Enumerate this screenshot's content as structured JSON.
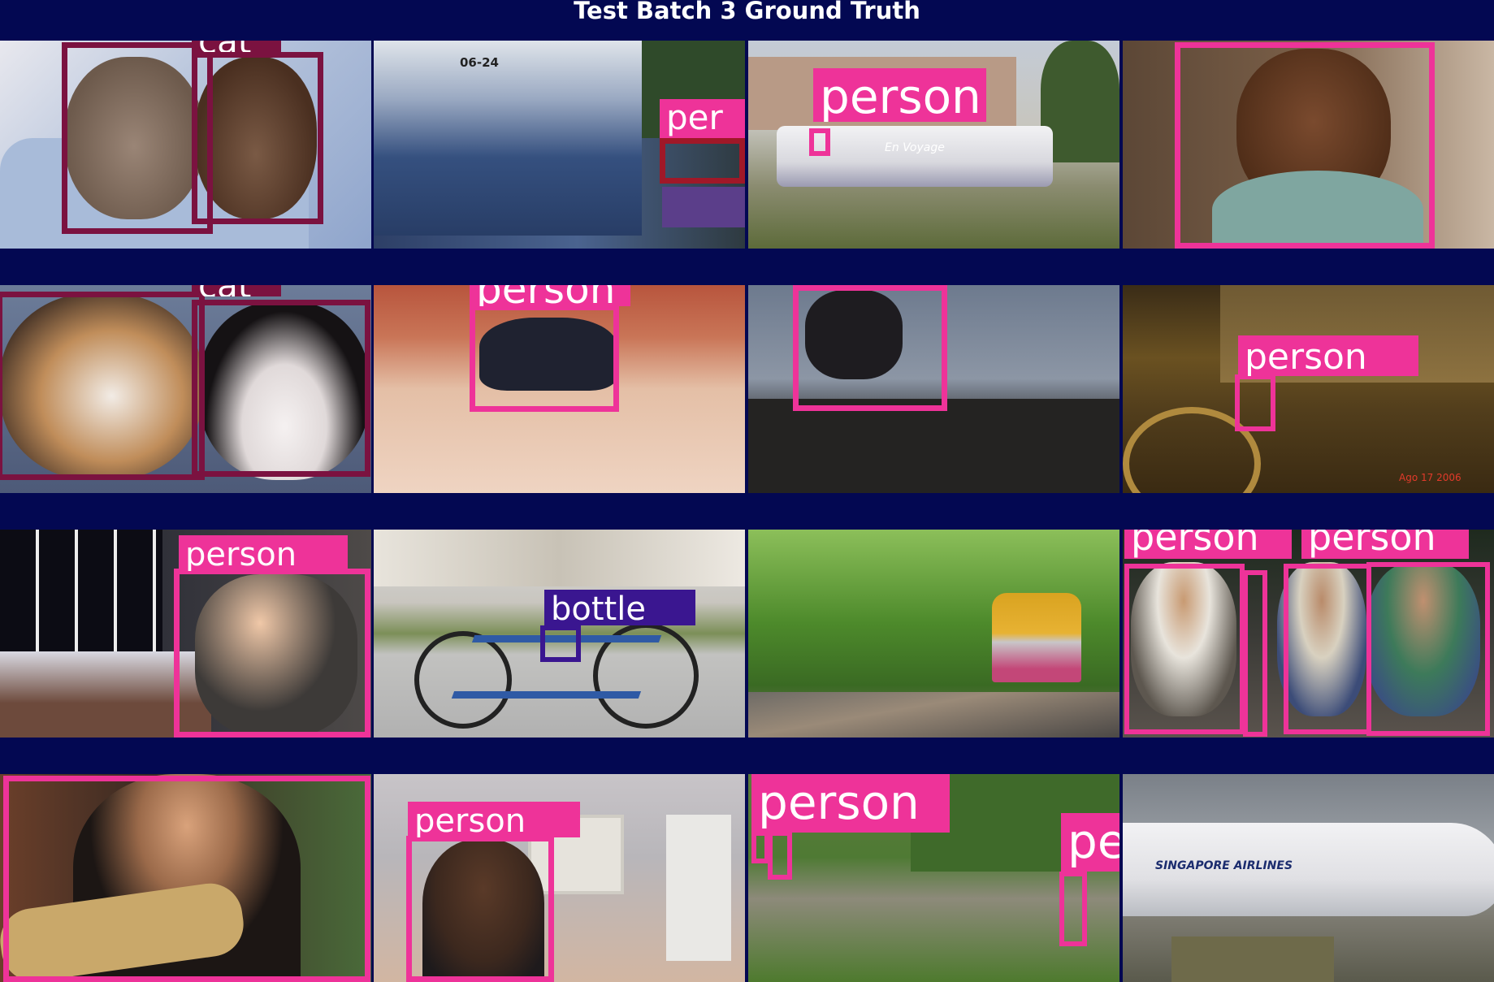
{
  "title": "Test Batch 3 Ground Truth",
  "colors": {
    "background": "#030852",
    "person": "#ee3399",
    "cat": "#7b1240",
    "bottle": "#3a1690",
    "bus_label": "#a01828"
  },
  "tiles": [
    {
      "name": "cats-on-pillow",
      "labels": [
        "cat"
      ]
    },
    {
      "name": "bus",
      "labels": [
        "per"
      ]
    },
    {
      "name": "train-white",
      "labels": [
        "person"
      ]
    },
    {
      "name": "woman-phone",
      "labels": []
    },
    {
      "name": "two-cats",
      "labels": [
        "cat"
      ]
    },
    {
      "name": "man-jumping",
      "labels": [
        "person"
      ]
    },
    {
      "name": "silhouette-jump",
      "labels": []
    },
    {
      "name": "night-plaza",
      "labels": [
        "person"
      ]
    },
    {
      "name": "woman-kitchen",
      "labels": [
        "person"
      ]
    },
    {
      "name": "bicycle",
      "labels": [
        "bottle"
      ]
    },
    {
      "name": "yellow-train",
      "labels": []
    },
    {
      "name": "guitarists",
      "labels": [
        "person",
        "person"
      ]
    },
    {
      "name": "singer-guitar",
      "labels": []
    },
    {
      "name": "girl-computer",
      "labels": [
        "person"
      ]
    },
    {
      "name": "garden-people",
      "labels": [
        "person",
        "pe"
      ]
    },
    {
      "name": "airplane",
      "labels": []
    }
  ],
  "airline_text": "SINGAPORE AIRLINES",
  "bus_number": "06-24",
  "date_stamp": "Ago 17 2006",
  "train_text": "En Voyage"
}
